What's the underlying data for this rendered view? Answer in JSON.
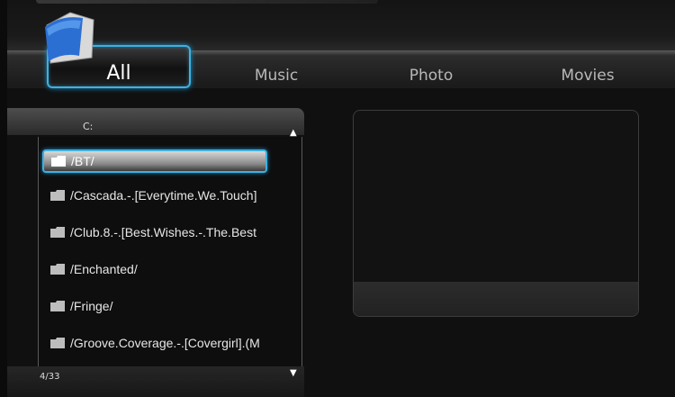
{
  "tabs": [
    {
      "label": "All",
      "active": true
    },
    {
      "label": "Music",
      "active": false
    },
    {
      "label": "Photo",
      "active": false
    },
    {
      "label": "Movies",
      "active": false
    }
  ],
  "browser": {
    "drive": "C:",
    "items": [
      {
        "label": "/BT/",
        "selected": true,
        "icon": "folder-icon"
      },
      {
        "label": "/Cascada.-.[Everytime.We.Touch]",
        "selected": false,
        "icon": "folder-icon"
      },
      {
        "label": "/Club.8.-.[Best.Wishes.-.The.Best",
        "selected": false,
        "icon": "folder-icon"
      },
      {
        "label": "/Enchanted/",
        "selected": false,
        "icon": "folder-icon"
      },
      {
        "label": "/Fringe/",
        "selected": false,
        "icon": "folder-icon"
      },
      {
        "label": "/Groove.Coverage.-.[Covergirl].(M",
        "selected": false,
        "icon": "folder-icon"
      }
    ],
    "page_indicator": "4/33",
    "scroll_up": "▲",
    "scroll_down": "▼"
  },
  "colors": {
    "accent": "#3fb0e0",
    "background": "#101010"
  }
}
